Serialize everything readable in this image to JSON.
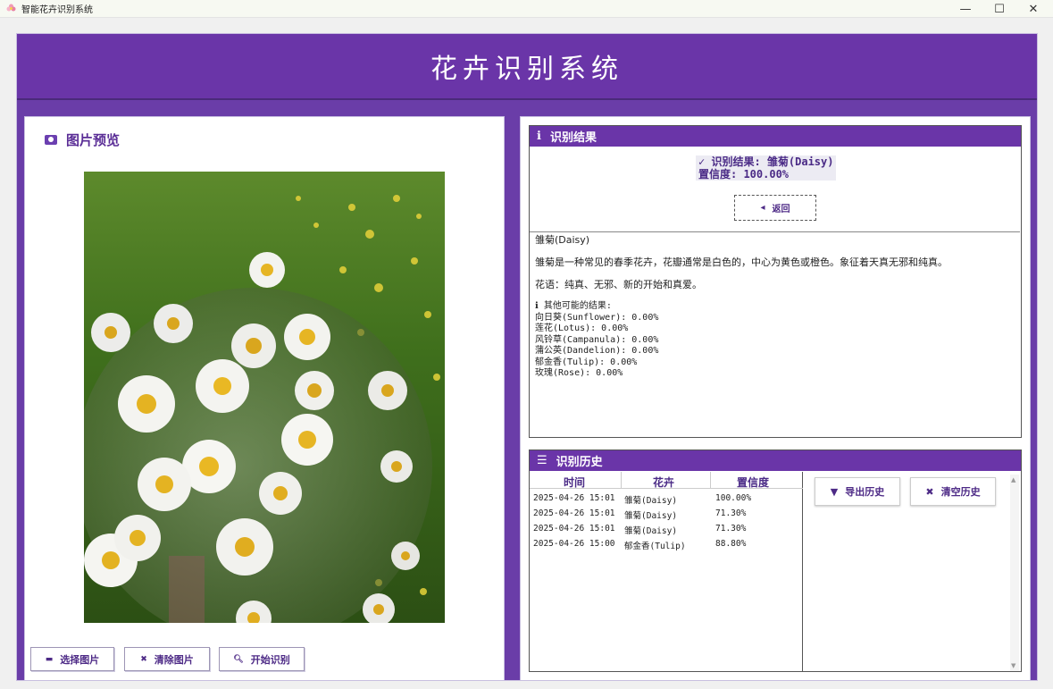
{
  "window": {
    "title": "智能花卉识别系统",
    "controls": [
      "—",
      "☐",
      "✕"
    ]
  },
  "header": {
    "title": "花卉识别系统"
  },
  "preview": {
    "title": "图片预览",
    "buttons": {
      "select": "选择图片",
      "clear": "清除图片",
      "start": "开始识别"
    }
  },
  "result": {
    "title": "识别结果",
    "summary_line1": "✓ 识别结果: 雏菊(Daisy)",
    "summary_line2": "置信度: 100.00%",
    "back_label": "返回",
    "detail_name": "雏菊(Daisy)",
    "detail_desc": "雏菊是一种常见的春季花卉，花瓣通常是白色的，中心为黄色或橙色。象征着天真无邪和纯真。",
    "detail_lang": "花语：纯真、无邪、新的开始和真爱。",
    "alt_title": "其他可能的结果:",
    "alternatives": [
      "向日葵(Sunflower): 0.00%",
      "莲花(Lotus): 0.00%",
      "风铃草(Campanula): 0.00%",
      "蒲公英(Dandelion): 0.00%",
      "郁金香(Tulip): 0.00%",
      "玫瑰(Rose): 0.00%"
    ]
  },
  "history": {
    "title": "识别历史",
    "columns": [
      "时间",
      "花卉",
      "置信度"
    ],
    "rows": [
      [
        "2025-04-26 15:01",
        "雏菊(Daisy)",
        "100.00%"
      ],
      [
        "2025-04-26 15:01",
        "雏菊(Daisy)",
        "71.30%"
      ],
      [
        "2025-04-26 15:01",
        "雏菊(Daisy)",
        "71.30%"
      ],
      [
        "2025-04-26 15:00",
        "郁金香(Tulip)",
        "88.80%"
      ]
    ],
    "export_label": "导出历史",
    "clear_label": "清空历史"
  },
  "colors": {
    "brand": "#6a35a8",
    "text_accent": "#4d2a86"
  }
}
